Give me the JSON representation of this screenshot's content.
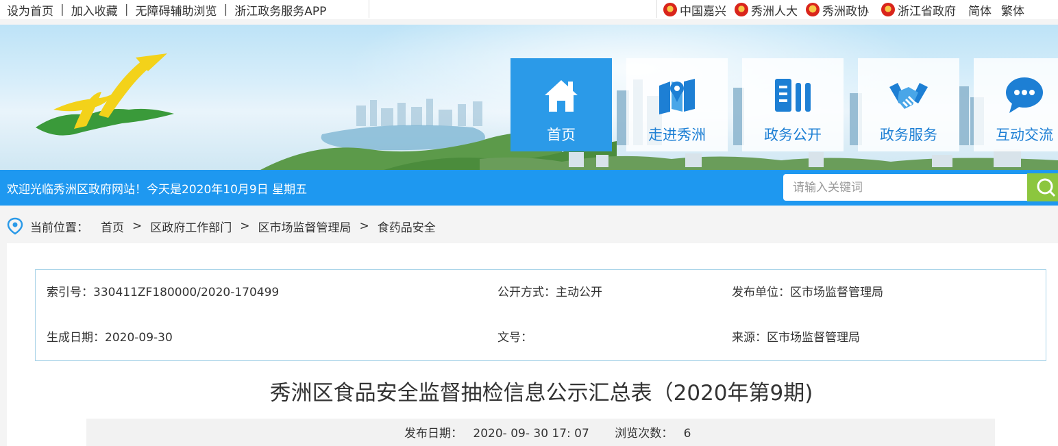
{
  "topbar": {
    "left_links": [
      "设为首页",
      "加入收藏",
      "无障碍辅助浏览",
      "浙江政务服务APP"
    ],
    "separator": "|",
    "right_links": [
      "中国嘉兴",
      "秀洲人大",
      "秀洲政协",
      "浙江省政府",
      "简体",
      "繁体"
    ]
  },
  "nav": {
    "items": [
      {
        "label": "首页",
        "icon": "home-icon",
        "active": true
      },
      {
        "label": "走进秀洲",
        "icon": "map-icon",
        "active": false
      },
      {
        "label": "政务公开",
        "icon": "document-icon",
        "active": false
      },
      {
        "label": "政务服务",
        "icon": "handshake-icon",
        "active": false
      },
      {
        "label": "互动交流",
        "icon": "chat-icon",
        "active": false
      }
    ]
  },
  "welcome": {
    "message": "欢迎光临秀洲区政府网站！今天是2020年10月9日 星期五",
    "search_placeholder": "请输入关键词"
  },
  "breadcrumb": {
    "prefix": "当前位置：",
    "items": [
      "首页",
      "区政府工作部门",
      "区市场监督管理局",
      "食药品安全"
    ],
    "separator": ">"
  },
  "meta": {
    "index_no": "索引号：330411ZF180000/2020-170499",
    "open_mode": "公开方式：主动公开",
    "publisher": "发布单位：区市场监督管理局",
    "created": "生成日期：2020-09-30",
    "doc_no": "文号：",
    "source": "来源：区市场监督管理局"
  },
  "article": {
    "title": "秀洲区食品安全监督抽检信息公示汇总表（2020年第9期)",
    "publish_label": "发布日期：",
    "publish_value": "2020- 09- 30 17: 07",
    "views_label": "浏览次数：",
    "views_value": "6"
  },
  "colors": {
    "primary_blue": "#1e98f0",
    "active_tile": "#2b9ae8",
    "search_button": "#8cc63e",
    "meta_border": "#a8d3e8"
  }
}
